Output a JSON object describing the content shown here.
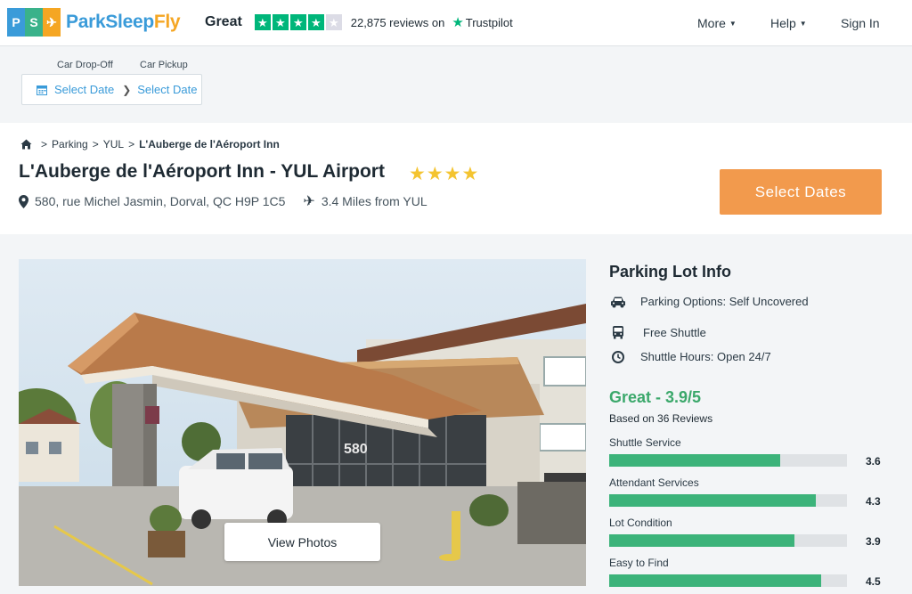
{
  "header": {
    "logo_text_main": "ParkSleep",
    "logo_text_accent": "Fly",
    "logo_tiles": [
      {
        "glyph": "P",
        "color": "#3a9bd9"
      },
      {
        "glyph": "S",
        "color": "#3ab28a"
      },
      {
        "glyph": "✈",
        "color": "#f5a623"
      }
    ],
    "trustpilot": {
      "label": "Great",
      "stars_filled": 4,
      "stars_total": 5,
      "reviews_text": "22,875 reviews on",
      "brand": "Trustpilot"
    },
    "nav": {
      "more": "More",
      "help": "Help",
      "sign_in": "Sign In"
    }
  },
  "dates": {
    "dropoff_label": "Car Drop-Off",
    "pickup_label": "Car Pickup",
    "dropoff_value": "Select Date",
    "pickup_value": "Select Date"
  },
  "breadcrumb": {
    "items": [
      "Parking",
      "YUL"
    ],
    "current": "L'Auberge de l'Aéroport Inn"
  },
  "lot": {
    "title": "L'Auberge de l'Aéroport Inn - YUL Airport",
    "stars": 4,
    "address": "580, rue Michel Jasmin, Dorval, QC H9P 1C5",
    "distance": "3.4 Miles from YUL",
    "select_button": "Select Dates"
  },
  "photo": {
    "building_number": "580",
    "view_button": "View Photos"
  },
  "info": {
    "title": "Parking Lot Info",
    "options": "Parking Options: Self Uncovered",
    "shuttle": "Free Shuttle",
    "hours": "Shuttle Hours: Open 24/7",
    "rating": "Great - 3.9/5",
    "based_on": "Based on 36 Reviews",
    "metrics": [
      {
        "label": "Shuttle Service",
        "value": "3.6",
        "fraction": 0.72
      },
      {
        "label": "Attendant Services",
        "value": "4.3",
        "fraction": 0.87
      },
      {
        "label": "Lot Condition",
        "value": "3.9",
        "fraction": 0.78
      },
      {
        "label": "Easy to Find",
        "value": "4.5",
        "fraction": 0.89
      }
    ]
  },
  "colors": {
    "accent_blue": "#3a9bd9",
    "cta_orange": "#f29a4d",
    "rating_green": "#3ba86b",
    "bar_green": "#3cb37a",
    "star_gold": "#f4c430",
    "trustpilot_green": "#00b67a"
  }
}
